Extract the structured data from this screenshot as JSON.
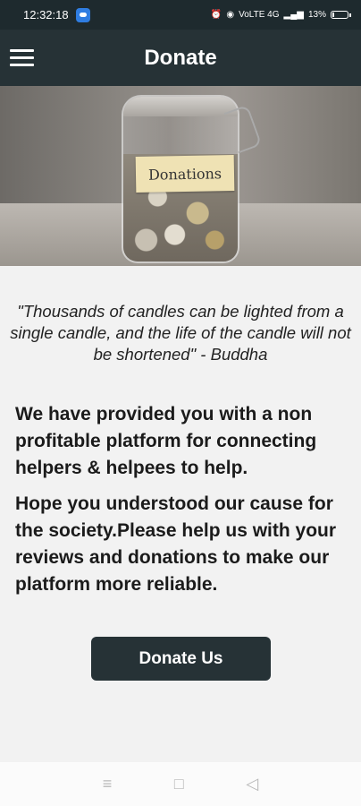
{
  "status_bar": {
    "time": "12:32:18",
    "network": "VoLTE 4G",
    "battery_text": "13%",
    "battery_level": 0.13
  },
  "app_bar": {
    "title": "Donate",
    "menu_icon": "hamburger-menu-icon"
  },
  "hero": {
    "jar_label": "Donations"
  },
  "content": {
    "quote": "\"Thousands of candles can be lighted from a single candle, and the life of the candle will not be shortened\" - Buddha",
    "paragraph1": "We have provided you with a non profitable platform for connecting helpers & helpees to help.",
    "paragraph2": "Hope you understood our cause for the society.Please help us with your reviews and donations to make our platform more reliable.",
    "button_label": "Donate Us"
  },
  "nav_bar": {
    "recents_icon": "≡",
    "home_icon": "□",
    "back_icon": "◁"
  },
  "colors": {
    "primary": "#263236",
    "background": "#f2f2f2"
  }
}
